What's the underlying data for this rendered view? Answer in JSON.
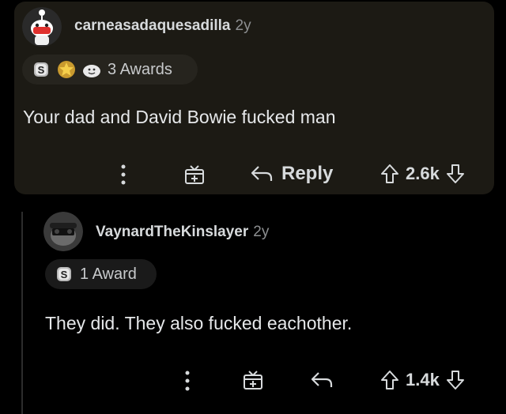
{
  "parent_comment": {
    "username": "carneasadaquesadilla",
    "age": "2y",
    "awards_text": "3 Awards",
    "award_icons": [
      "silver-award-icon",
      "gold-star-award-icon",
      "wholesome-award-icon"
    ],
    "body": "Your dad and David Bowie fucked man",
    "reply_label": "Reply",
    "score": "2.6k"
  },
  "reply_comment": {
    "username": "VaynardTheKinslayer",
    "age": "2y",
    "awards_text": "1 Award",
    "award_icons": [
      "silver-award-icon"
    ],
    "body": "They did. They also fucked eachother.",
    "score": "1.4k"
  },
  "colors": {
    "background": "#000000",
    "card": "#1c1a14",
    "text": "#d7dadc",
    "muted": "#8d8f91"
  }
}
